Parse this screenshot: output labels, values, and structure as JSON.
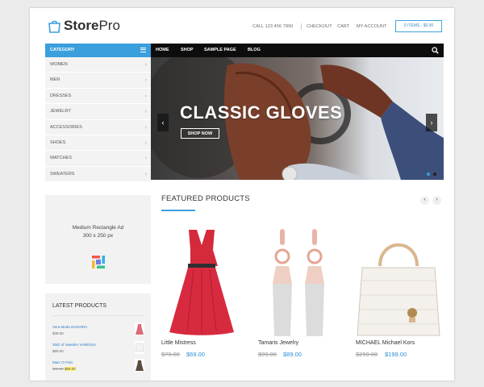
{
  "header": {
    "logo_bold": "Store",
    "logo_light": "Pro",
    "phone": "CALL 123 456 7890",
    "checkout": "CHECKOUT",
    "cart": "CART",
    "my_account": "MY ACCOUNT",
    "cart_summary": "0 ITEMS - $0.00"
  },
  "sidebar": {
    "category_title": "CATEGORY",
    "items": [
      {
        "label": "WOMEN"
      },
      {
        "label": "MEN"
      },
      {
        "label": "DRESSES"
      },
      {
        "label": "JEWELRY"
      },
      {
        "label": "ACCESSORIES"
      },
      {
        "label": "SHOES"
      },
      {
        "label": "WATCHES"
      },
      {
        "label": "SWEATERS"
      }
    ],
    "chevron": "›"
  },
  "nav": {
    "items": [
      {
        "label": "HOME"
      },
      {
        "label": "SHOP"
      },
      {
        "label": "SAMPLE PAGE"
      },
      {
        "label": "BLOG"
      }
    ]
  },
  "hero": {
    "title": "CLASSIC GLOVES",
    "button": "SHOP NOW",
    "prev": "‹",
    "next": "›"
  },
  "ad": {
    "line1": "Medium Rectangle Ad",
    "line2": "300 x 250 px"
  },
  "latest": {
    "title": "LATEST PRODUCTS",
    "items": [
      {
        "name": "Vera Moda ISADORA",
        "price": "$39.00"
      },
      {
        "name": "SND of Sweden VANESSA",
        "price": "$59.00"
      },
      {
        "name": "Marc O Polo",
        "old_price": "$99.00",
        "price": "$59.00"
      }
    ]
  },
  "featured": {
    "title": "FEATURED PRODUCTS",
    "prev": "‹",
    "next": "›",
    "products": [
      {
        "name": "Little Mistress",
        "old_price": "$79.00",
        "price": "$69.00"
      },
      {
        "name": "Tamaris Jewelry",
        "old_price": "$99.00",
        "price": "$89.00"
      },
      {
        "name": "MICHAEL Michael Kors",
        "old_price": "$259.00",
        "price": "$199.00"
      }
    ]
  },
  "colors": {
    "accent": "#3a9fdc",
    "nav_bg": "#0d0d0d",
    "price": "#2b8fd6"
  }
}
